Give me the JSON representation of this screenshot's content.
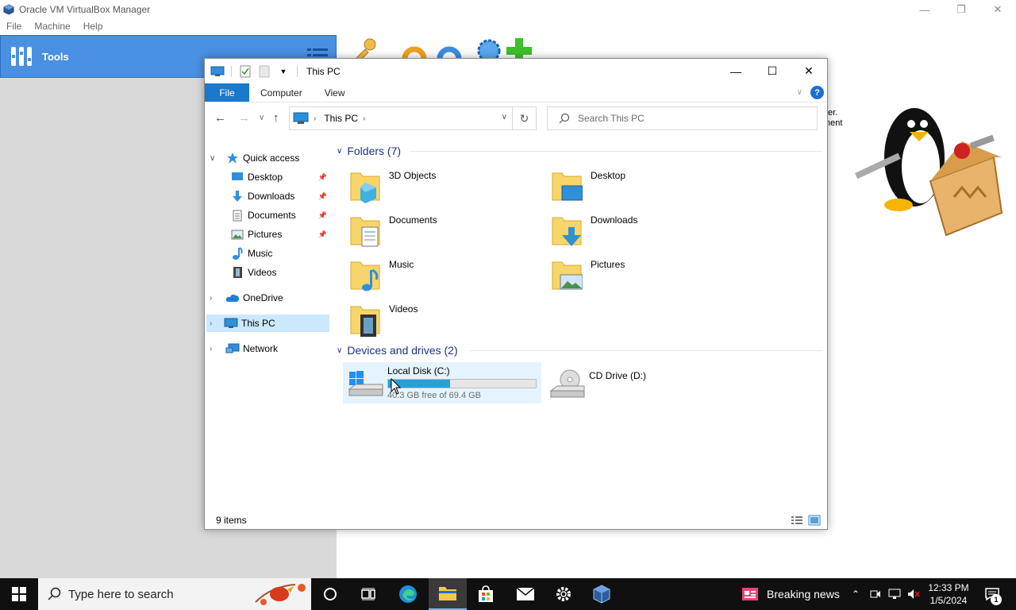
{
  "vbox": {
    "title": "Oracle VM VirtualBox Manager",
    "menu": [
      "File",
      "Machine",
      "Help"
    ],
    "tools_label": "Tools",
    "welcome_lines": [
      "ter.",
      "nent"
    ]
  },
  "explorer": {
    "title": "This PC",
    "ribbon_tabs": [
      "File",
      "Computer",
      "View"
    ],
    "address": {
      "location": "This PC"
    },
    "search": {
      "placeholder": "Search This PC"
    },
    "nav": {
      "quick_access": "Quick access",
      "quick_items": [
        "Desktop",
        "Downloads",
        "Documents",
        "Pictures",
        "Music",
        "Videos"
      ],
      "onedrive": "OneDrive",
      "this_pc": "This PC",
      "network": "Network"
    },
    "folders_header": "Folders (7)",
    "folders": [
      "3D Objects",
      "Desktop",
      "Documents",
      "Downloads",
      "Music",
      "Pictures",
      "Videos"
    ],
    "devices_header": "Devices and drives (2)",
    "drives": [
      {
        "name": "Local Disk (C:)",
        "free_text": "40.3 GB free of 69.4 GB",
        "used_fraction": 0.42
      },
      {
        "name": "CD Drive (D:)"
      }
    ],
    "status": "9 items"
  },
  "taskbar": {
    "search_placeholder": "Type here to search",
    "news": "Breaking news",
    "time": "12:33 PM",
    "date": "1/5/2024",
    "notification_count": "1"
  },
  "colors": {
    "accent": "#1979ca",
    "vbox_selected": "#4a90e2",
    "selection": "#cce8ff",
    "drive_fill": "#26a0da",
    "taskbar": "#101010"
  }
}
